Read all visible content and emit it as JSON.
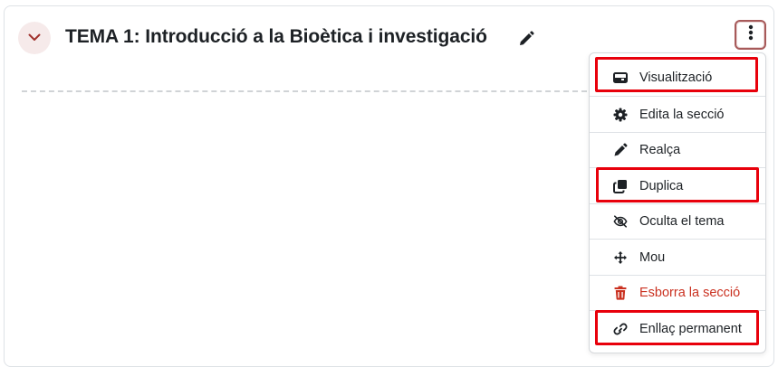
{
  "section": {
    "title": "TEMA 1: Introducció a la Bioètica i investigació"
  },
  "menu": {
    "items": [
      {
        "label": "Visualització",
        "icon": "card-icon"
      },
      {
        "label": "Edita la secció",
        "icon": "gear-icon"
      },
      {
        "label": "Realça",
        "icon": "pen-icon"
      },
      {
        "label": "Duplica",
        "icon": "copy-icon"
      },
      {
        "label": "Oculta el tema",
        "icon": "eye-slash-icon"
      },
      {
        "label": "Mou",
        "icon": "move-icon"
      },
      {
        "label": "Esborra la secció",
        "icon": "trash-icon"
      },
      {
        "label": "Enllaç permanent",
        "icon": "link-icon"
      }
    ]
  },
  "colors": {
    "accent": "#a75a5a",
    "danger": "#ca3120",
    "highlight": "#e8000b"
  }
}
